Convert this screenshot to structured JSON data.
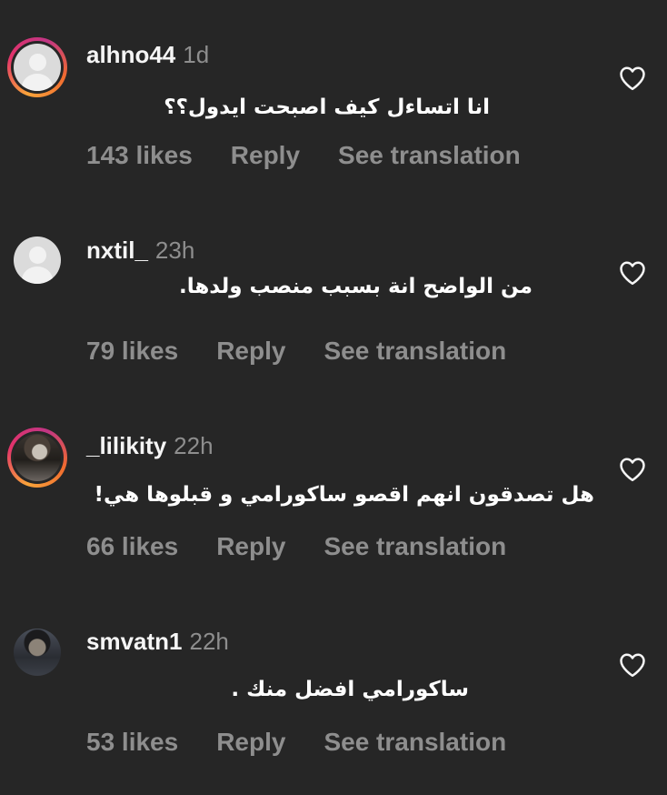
{
  "comments": [
    {
      "username": "alhno44",
      "time": "1d",
      "text": "انا اتساءل كيف اصبحت ايدول؟؟",
      "likes": "143 likes",
      "reply": "Reply",
      "translate": "See translation"
    },
    {
      "username": "nxtil_",
      "time": "23h",
      "text": "من الواضح انة بسبب منصب ولدها.",
      "likes": "79 likes",
      "reply": "Reply",
      "translate": "See translation"
    },
    {
      "username": "_lilikity",
      "time": "22h",
      "text": "هل تصدقون انهم اقصو ساكورامي و قبلوها هي!",
      "likes": "66 likes",
      "reply": "Reply",
      "translate": "See translation"
    },
    {
      "username": "smvatn1",
      "time": "22h",
      "text": "ساكورامي افضل منك .",
      "likes": "53 likes",
      "reply": "Reply",
      "translate": "See translation"
    }
  ],
  "icons": {
    "like": "heart-outline-icon",
    "default_avatar": "default-user-icon"
  },
  "colors": {
    "background": "#262626",
    "primary_text": "#f5f5f5",
    "secondary_text": "#8e8e8e"
  }
}
